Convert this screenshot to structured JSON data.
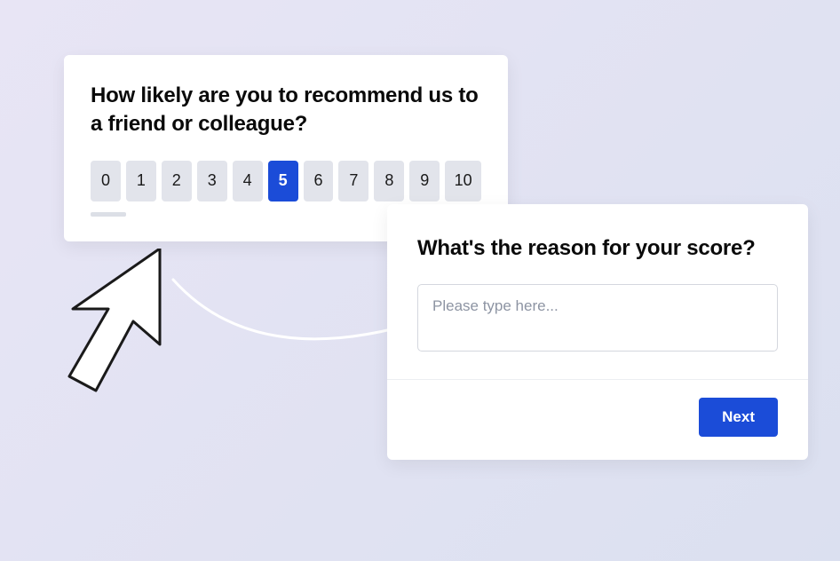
{
  "nps": {
    "question": "How likely are you to recommend us to a friend or colleague?",
    "options": [
      "0",
      "1",
      "2",
      "3",
      "4",
      "5",
      "6",
      "7",
      "8",
      "9",
      "10"
    ],
    "selected": "5"
  },
  "reason": {
    "question": "What's the reason for your score?",
    "placeholder": "Please type here...",
    "next_label": "Next"
  },
  "colors": {
    "accent": "#1b4cd8"
  }
}
